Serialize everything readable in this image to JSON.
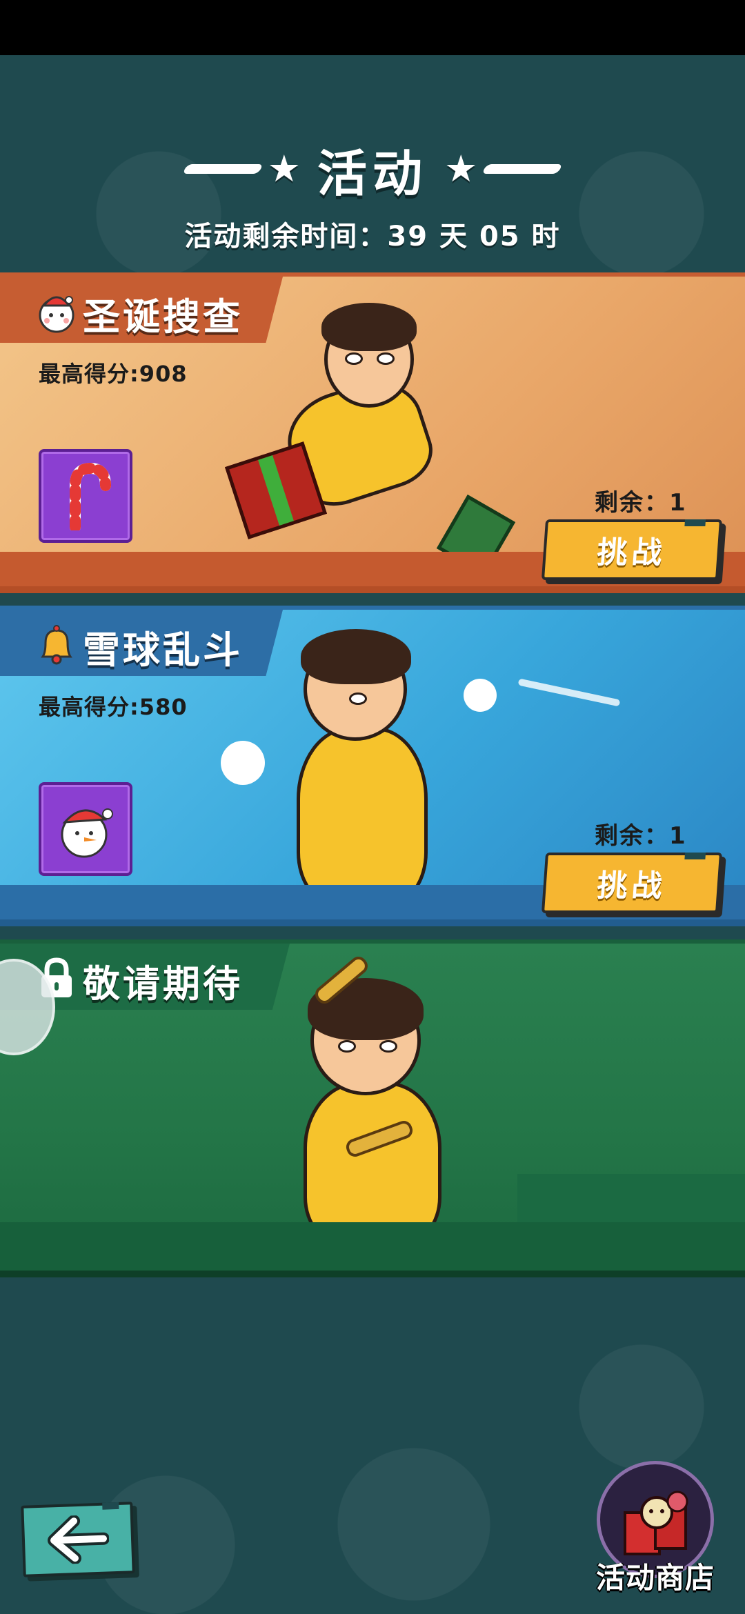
{
  "header": {
    "title": "活动",
    "remaining_time": "活动剩余时间：39 天 05 时"
  },
  "events": [
    {
      "title": "圣诞搜查",
      "best_score": "最高得分:908",
      "remaining": "剩余：1",
      "challenge_label": "挑战",
      "reward_icon": "candy-cane-icon",
      "title_icon": "snowman-icon"
    },
    {
      "title": "雪球乱斗",
      "best_score": "最高得分:580",
      "remaining": "剩余：1",
      "challenge_label": "挑战",
      "reward_icon": "snowman-head-icon",
      "title_icon": "bell-icon"
    },
    {
      "title": "敬请期待",
      "title_icon": "lock-icon"
    }
  ],
  "footer": {
    "back_icon": "arrow-left-icon",
    "shop_label": "活动商店"
  },
  "colors": {
    "background": "#1f4a4f",
    "xmas_card": "#e9a769",
    "snow_card": "#38a6db",
    "lock_card": "#237547",
    "button": "#f6b631",
    "reward_box": "#8b3fd1"
  }
}
